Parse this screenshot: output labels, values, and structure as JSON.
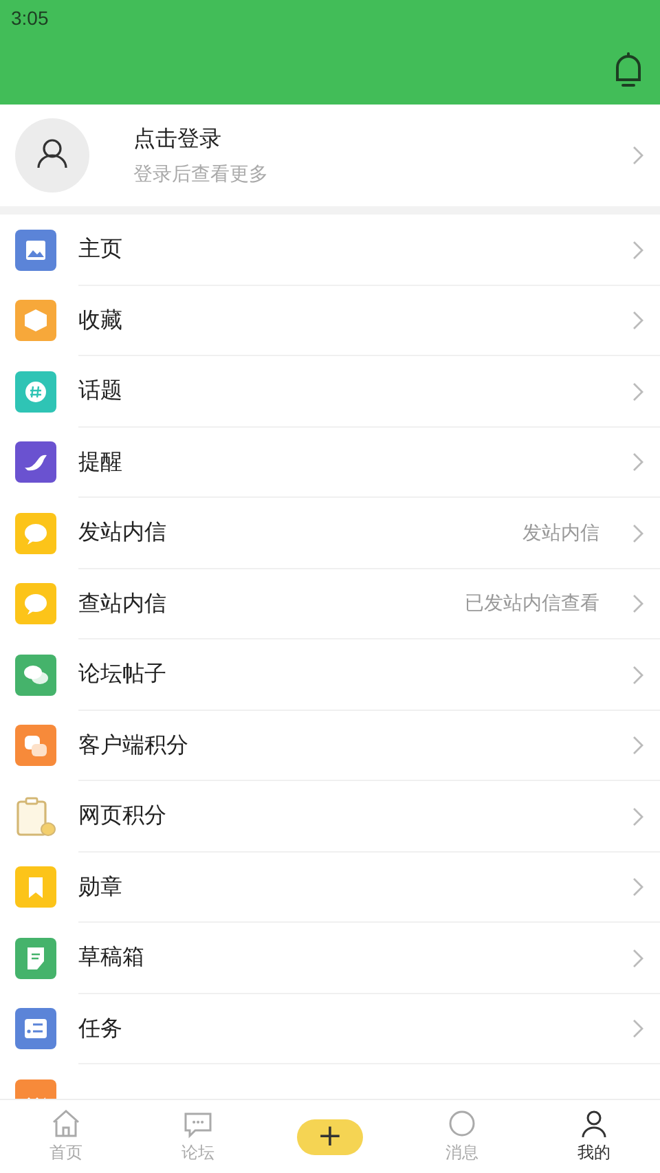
{
  "status_bar": {
    "time": "3:05"
  },
  "profile": {
    "title": "点击登录",
    "subtitle": "登录后查看更多"
  },
  "menu": [
    {
      "label": "主页"
    },
    {
      "label": "收藏"
    },
    {
      "label": "话题"
    },
    {
      "label": "提醒"
    },
    {
      "label": "发站内信",
      "note": "发站内信"
    },
    {
      "label": "查站内信",
      "note": "已发站内信查看"
    },
    {
      "label": "论坛帖子"
    },
    {
      "label": "客户端积分"
    },
    {
      "label": "网页积分"
    },
    {
      "label": "勋章"
    },
    {
      "label": "草稿箱"
    },
    {
      "label": "任务"
    }
  ],
  "bottom_nav": [
    {
      "kind": "tab",
      "label": "首页",
      "selected": false
    },
    {
      "kind": "tab",
      "label": "论坛",
      "selected": false
    },
    {
      "kind": "add",
      "label": "+",
      "selected": false
    },
    {
      "kind": "tab",
      "label": "消息",
      "selected": false
    },
    {
      "kind": "tab",
      "label": "我的",
      "selected": true
    }
  ]
}
